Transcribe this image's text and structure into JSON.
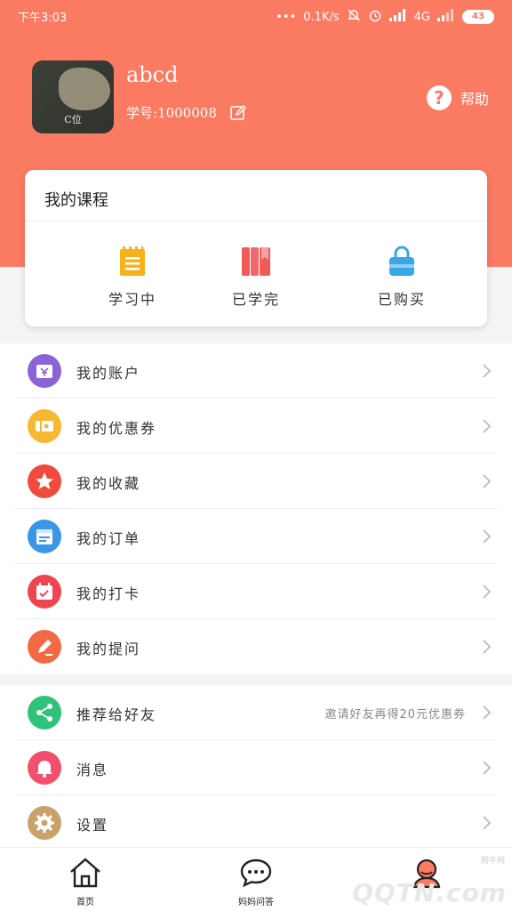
{
  "status_bar": {
    "time": "下午3:03",
    "speed": "0.1K/s",
    "network": "4G",
    "battery": "43"
  },
  "profile": {
    "avatar_text": "C位",
    "username": "abcd",
    "student_id": "学号:1000008",
    "help_label": "帮助"
  },
  "courses": {
    "title": "我的课程",
    "items": [
      {
        "label": "学习中",
        "icon": "clipboard-icon",
        "color": "#f6b21a"
      },
      {
        "label": "已学完",
        "icon": "book-icon",
        "color": "#f25a5a"
      },
      {
        "label": "已购买",
        "icon": "shopping-bag-icon",
        "color": "#3aa6e8"
      }
    ]
  },
  "menu": {
    "group1": [
      {
        "label": "我的账户",
        "icon": "wallet-icon",
        "color": "#8a64d6"
      },
      {
        "label": "我的优惠券",
        "icon": "coupon-icon",
        "color": "#f7b731"
      },
      {
        "label": "我的收藏",
        "icon": "star-icon",
        "color": "#ef4a3c"
      },
      {
        "label": "我的订单",
        "icon": "order-icon",
        "color": "#3a97e8"
      },
      {
        "label": "我的打卡",
        "icon": "calendar-icon",
        "color": "#ee4650"
      },
      {
        "label": "我的提问",
        "icon": "pencil-icon",
        "color": "#f26a43"
      }
    ],
    "group2": [
      {
        "label": "推荐给好友",
        "icon": "share-icon",
        "color": "#2ec27a",
        "note": "邀请好友再得20元优惠券"
      },
      {
        "label": "消息",
        "icon": "bell-icon",
        "color": "#f0506e"
      },
      {
        "label": "设置",
        "icon": "gear-icon",
        "color": "#c9a26a"
      }
    ]
  },
  "tabs": [
    {
      "label": "首页",
      "icon": "home-icon"
    },
    {
      "label": "妈妈问答",
      "icon": "chat-icon"
    },
    {
      "label": "",
      "icon": "profile-icon"
    }
  ],
  "watermark": "QQTN.com",
  "watermark_small": "腾牛网"
}
